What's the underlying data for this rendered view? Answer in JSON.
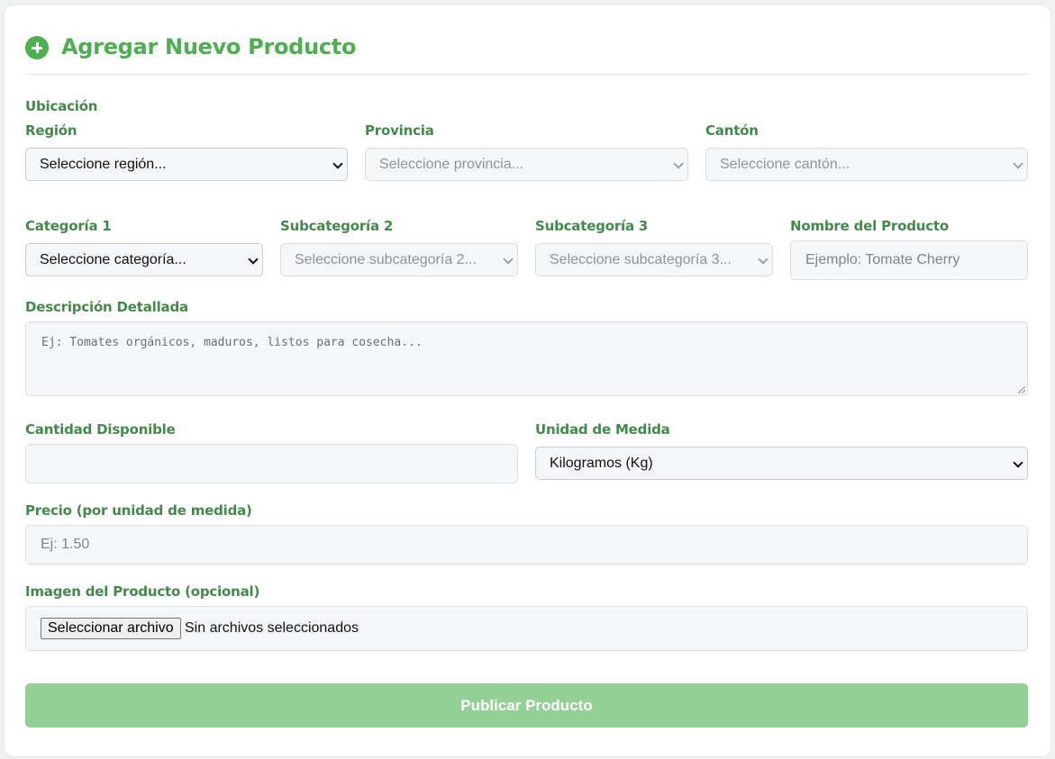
{
  "header": {
    "title": "Agregar Nuevo Producto",
    "icon": "plus-circle-icon"
  },
  "location": {
    "section_label": "Ubicación",
    "region": {
      "label": "Región",
      "value": "Seleccione región..."
    },
    "province": {
      "label": "Provincia",
      "value": "Seleccione provincia..."
    },
    "canton": {
      "label": "Cantón",
      "value": "Seleccione cantón..."
    }
  },
  "categories": {
    "cat1": {
      "label": "Categoría 1",
      "value": "Seleccione categoría..."
    },
    "cat2": {
      "label": "Subcategoría 2",
      "value": "Seleccione subcategoría 2..."
    },
    "cat3": {
      "label": "Subcategoría 3",
      "value": "Seleccione subcategoría 3..."
    }
  },
  "product_name": {
    "label": "Nombre del Producto",
    "placeholder": "Ejemplo: Tomate Cherry"
  },
  "description": {
    "label": "Descripción Detallada",
    "placeholder": "Ej: Tomates orgánicos, maduros, listos para cosecha..."
  },
  "quantity": {
    "label": "Cantidad Disponible",
    "value": ""
  },
  "unit": {
    "label": "Unidad de Medida",
    "value": "Kilogramos (Kg)"
  },
  "price": {
    "label": "Precio (por unidad de medida)",
    "placeholder": "Ej: 1.50"
  },
  "image": {
    "label": "Imagen del Producto (opcional)",
    "button": "Seleccionar archivo",
    "status": "Sin archivos seleccionados"
  },
  "submit": {
    "label": "Publicar Producto"
  },
  "colors": {
    "accent": "#4caf50",
    "label": "#43894a",
    "submit_bg": "#93d095"
  }
}
